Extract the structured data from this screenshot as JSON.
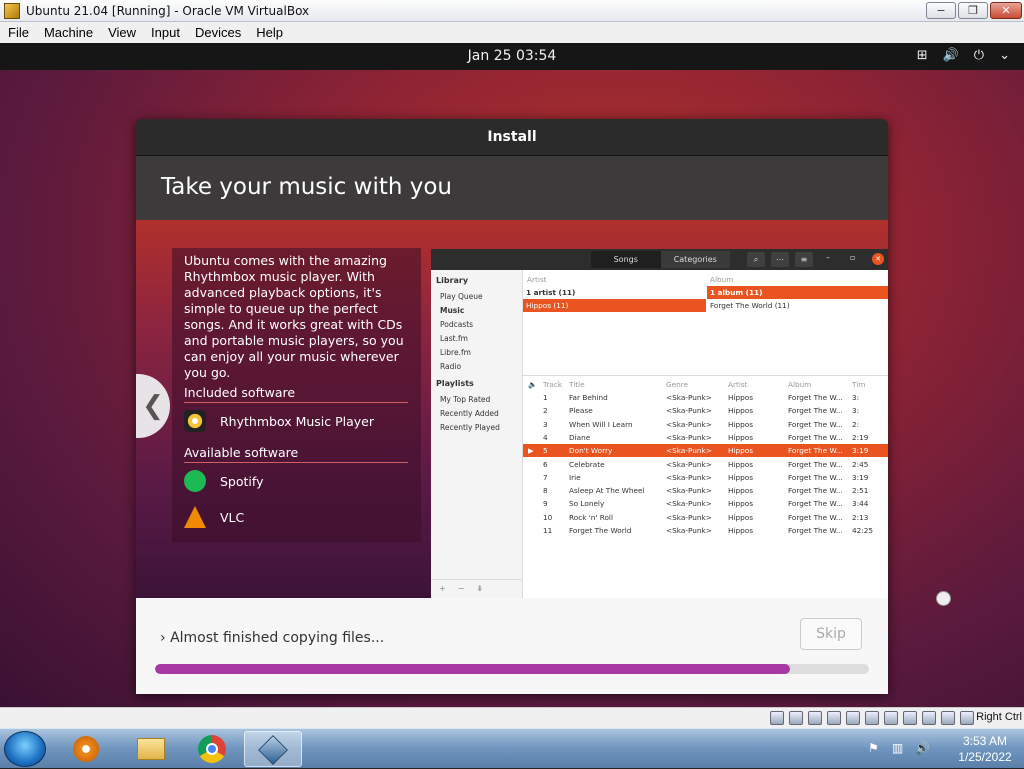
{
  "window": {
    "title": "Ubuntu 21.04 [Running] - Oracle VM VirtualBox",
    "minimize": "−",
    "maximize": "❐",
    "close": "✕"
  },
  "menu": [
    "File",
    "Machine",
    "View",
    "Input",
    "Devices",
    "Help"
  ],
  "guest": {
    "clock": "Jan 25  03:54",
    "tray_icons": [
      "network-icon",
      "volume-icon",
      "power-icon",
      "chevron-down-icon"
    ]
  },
  "installer": {
    "title": "Install",
    "slide_title": "Take your music with you",
    "description": "Ubuntu comes with the amazing Rhythmbox music player. With advanced playback options, it's simple to queue up the perfect songs. And it works great with CDs and portable music players, so you can enjoy all your music wherever you go.",
    "included_heading": "Included software",
    "included": [
      {
        "name": "Rhythmbox Music Player",
        "icon": "rhythmbox-icon"
      }
    ],
    "available_heading": "Available software",
    "available": [
      {
        "name": "Spotify",
        "icon": "spotify-icon"
      },
      {
        "name": "VLC",
        "icon": "vlc-icon"
      }
    ],
    "prev_arrow": "❮",
    "next_arrow": "❯",
    "status": "Almost finished copying files...",
    "skip": "Skip",
    "progress": 0.89
  },
  "rhythmbox": {
    "tabs": [
      "Songs",
      "Categories"
    ],
    "library_heading": "Library",
    "library": [
      "Play Queue",
      "Music",
      "Podcasts",
      "Last.fm",
      "Libre.fm",
      "Radio"
    ],
    "playlists_heading": "Playlists",
    "playlists": [
      "My Top Rated",
      "Recently Added",
      "Recently Played"
    ],
    "artist_header": "Artist",
    "album_header": "Album",
    "artist_rows": [
      "1 artist (11)",
      "Hippos (11)"
    ],
    "album_rows": [
      "1 album (11)",
      "Forget The World (11)"
    ],
    "columns": [
      "Track",
      "Title",
      "Genre",
      "Artist",
      "Album",
      "Tim"
    ],
    "tracks": [
      [
        "1",
        "Far Behind",
        "<Ska-Punk>",
        "Hippos",
        "Forget The W...",
        "3:"
      ],
      [
        "2",
        "Please",
        "<Ska-Punk>",
        "Hippos",
        "Forget The W...",
        "3:"
      ],
      [
        "3",
        "When Will I Learn",
        "<Ska-Punk>",
        "Hippos",
        "Forget The W...",
        "2:"
      ],
      [
        "4",
        "Diane",
        "<Ska-Punk>",
        "Hippos",
        "Forget The W...",
        "2:19"
      ],
      [
        "5",
        "Don't Worry",
        "<Ska-Punk>",
        "Hippos",
        "Forget The W...",
        "3:19"
      ],
      [
        "6",
        "Celebrate",
        "<Ska-Punk>",
        "Hippos",
        "Forget The W...",
        "2:45"
      ],
      [
        "7",
        "Irie",
        "<Ska-Punk>",
        "Hippos",
        "Forget The W...",
        "3:19"
      ],
      [
        "8",
        "Asleep At The Wheel",
        "<Ska-Punk>",
        "Hippos",
        "Forget The W...",
        "2:51"
      ],
      [
        "9",
        "So Lonely",
        "<Ska-Punk>",
        "Hippos",
        "Forget The W...",
        "3:44"
      ],
      [
        "10",
        "Rock 'n' Roll",
        "<Ska-Punk>",
        "Hippos",
        "Forget The W...",
        "2:13"
      ],
      [
        "11",
        "Forget The World",
        "<Ska-Punk>",
        "Hippos",
        "Forget The W...",
        "42:25"
      ]
    ],
    "selected_track": 4,
    "bottom_buttons": [
      "+",
      "−",
      "⇟"
    ]
  },
  "vbox_status": {
    "host_key": "Right Ctrl"
  },
  "taskbar": {
    "apps": [
      "media-player-icon",
      "file-explorer-icon",
      "chrome-icon",
      "virtualbox-icon"
    ],
    "time": "3:53 AM",
    "date": "1/25/2022"
  }
}
